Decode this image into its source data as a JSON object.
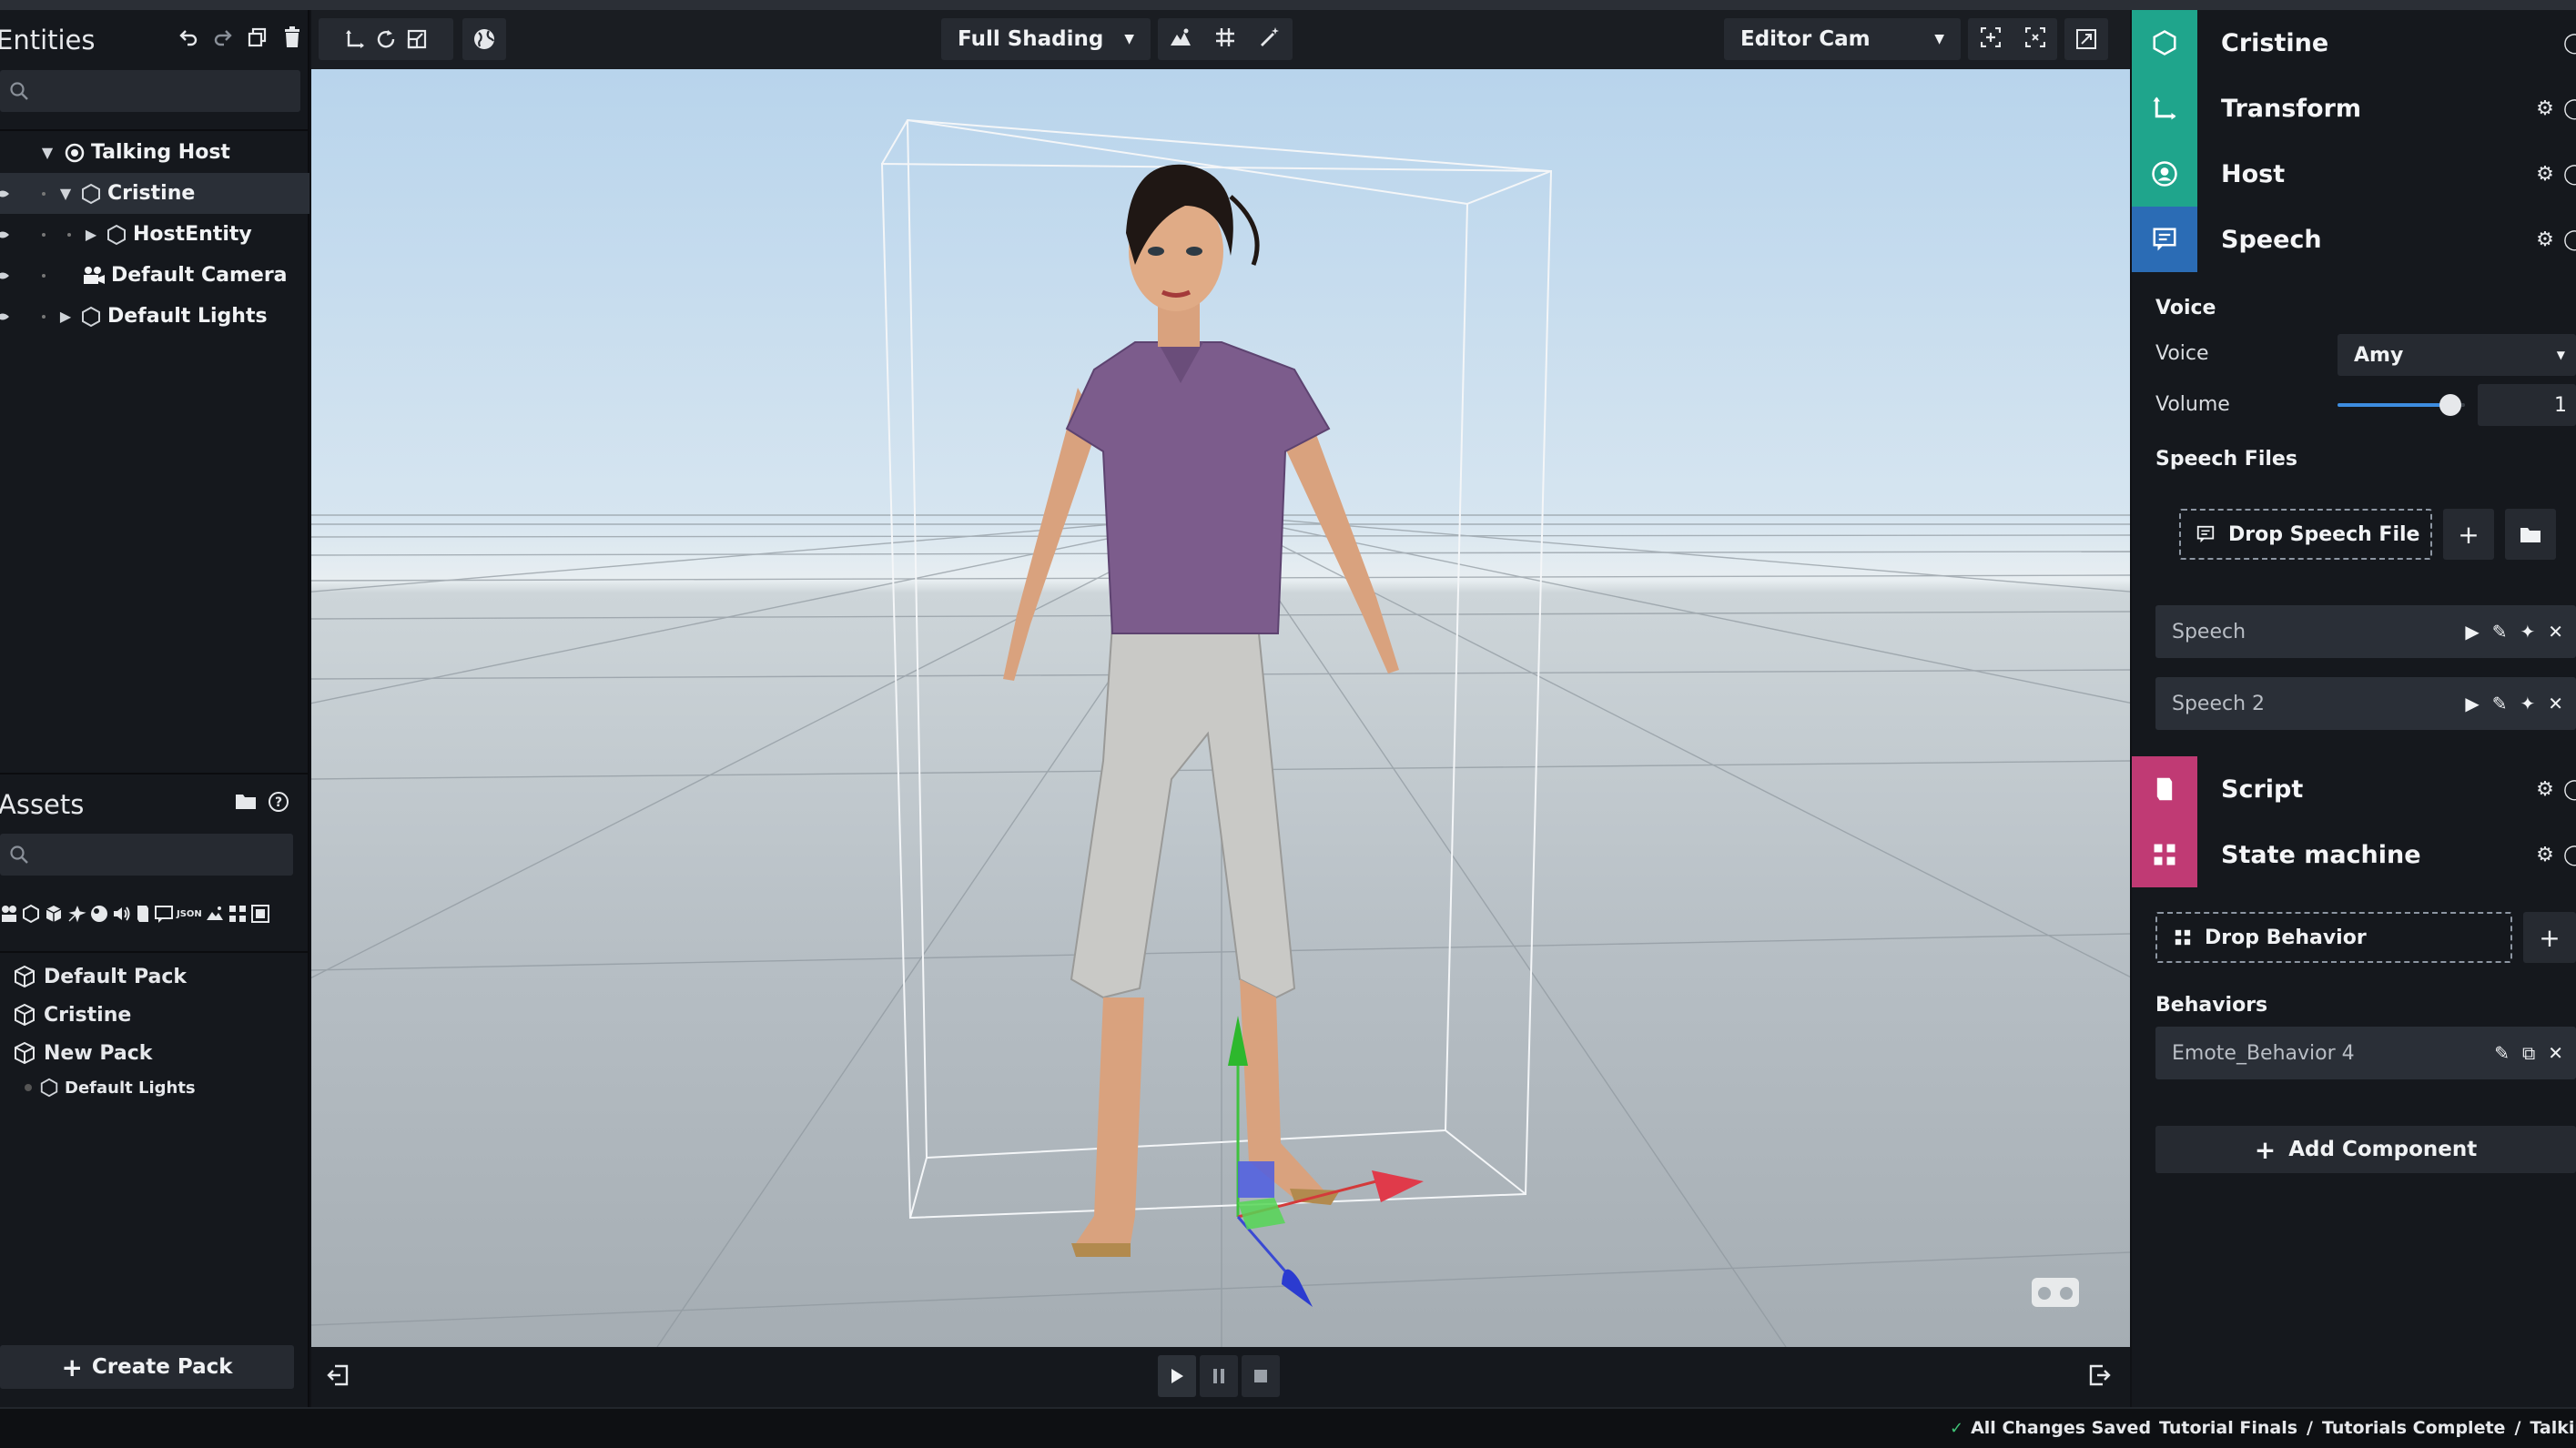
{
  "entities": {
    "title": "Entities",
    "search_placeholder": "",
    "tree": [
      {
        "label": "Talking Host"
      },
      {
        "label": "Cristine"
      },
      {
        "label": "HostEntity"
      },
      {
        "label": "Default Camera"
      },
      {
        "label": "Default Lights"
      }
    ]
  },
  "assets": {
    "title": "Assets",
    "filter_json_label": "JSON",
    "packs": [
      {
        "label": "Default Pack"
      },
      {
        "label": "Cristine"
      },
      {
        "label": "New Pack"
      },
      {
        "label": "Default Lights"
      }
    ],
    "create_pack_label": "Create Pack"
  },
  "viewport": {
    "shading": "Full Shading",
    "camera": "Editor Cam"
  },
  "inspector": {
    "components": [
      {
        "label": "Cristine",
        "color": "#1fa58c"
      },
      {
        "label": "Transform",
        "color": "#1fa58c"
      },
      {
        "label": "Host",
        "color": "#1fa58c"
      },
      {
        "label": "Speech",
        "color": "#2b6cb5"
      }
    ],
    "voice_section": "Voice",
    "voice_label": "Voice",
    "voice_value": "Amy",
    "volume_label": "Volume",
    "volume_value": "1",
    "volume_level": 1.0,
    "speech_files_label": "Speech Files",
    "drop_speech_label": "Drop Speech File",
    "speeches": [
      {
        "label": "Speech"
      },
      {
        "label": "Speech 2"
      }
    ],
    "script_label": "Script",
    "script_color": "#c03a74",
    "state_machine_label": "State machine",
    "state_machine_color": "#c03a74",
    "drop_behavior_label": "Drop Behavior",
    "behaviors_label": "Behaviors",
    "behavior_item": "Emote_Behavior 4",
    "add_component_label": "Add Component"
  },
  "status": {
    "saved": "All Changes Saved",
    "breadcrumb": [
      "Tutorial Finals",
      "Tutorials Complete",
      "Talking Hos"
    ]
  }
}
